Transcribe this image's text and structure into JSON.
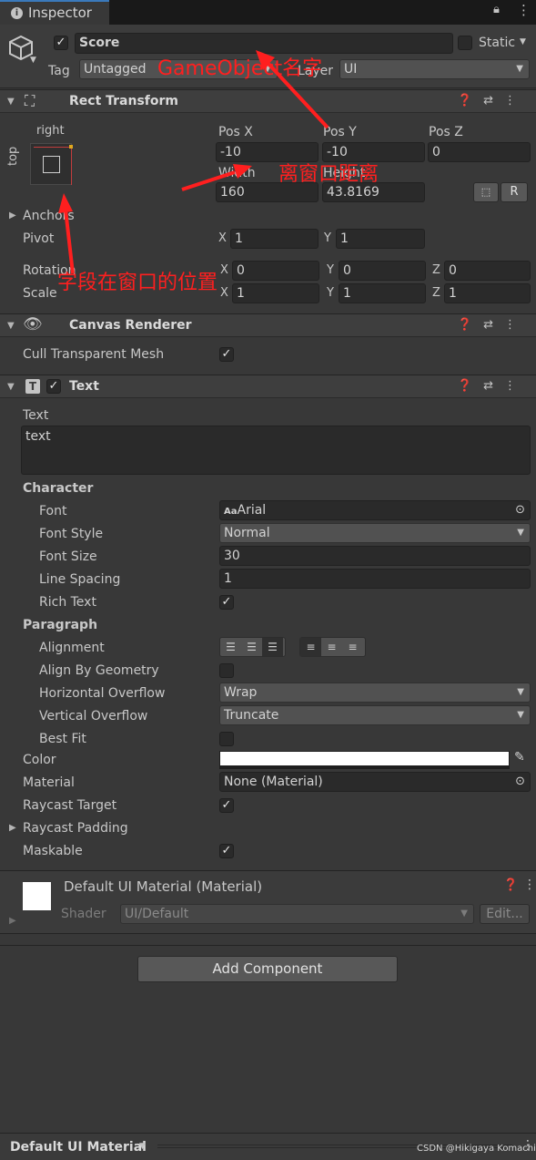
{
  "window": {
    "tab_title": "Inspector"
  },
  "gameobject": {
    "name": "Score",
    "static_label": "Static",
    "tag_label": "Tag",
    "tag_value": "Untagged",
    "layer_label": "Layer",
    "layer_value": "UI"
  },
  "rect_transform": {
    "title": "Rect Transform",
    "anchor_h": "right",
    "anchor_v": "top",
    "posx_label": "Pos X",
    "posy_label": "Pos Y",
    "posz_label": "Pos Z",
    "posx": "-10",
    "posy": "-10",
    "posz": "0",
    "width_label": "Width",
    "height_label": "Height",
    "width": "160",
    "height": "43.8169",
    "r_button": "R",
    "anchors_label": "Anchors",
    "pivot_label": "Pivot",
    "pivot_x": "1",
    "pivot_y": "1",
    "rotation_label": "Rotation",
    "rot_x": "0",
    "rot_y": "0",
    "rot_z": "0",
    "scale_label": "Scale",
    "scale_x": "1",
    "scale_y": "1",
    "scale_z": "1",
    "axis_x": "X",
    "axis_y": "Y",
    "axis_z": "Z"
  },
  "canvas_renderer": {
    "title": "Canvas Renderer",
    "cull_label": "Cull Transparent Mesh"
  },
  "text_component": {
    "title": "Text",
    "text_label": "Text",
    "text_value": "text",
    "character_label": "Character",
    "font_label": "Font",
    "font_value": "Arial",
    "font_style_label": "Font Style",
    "font_style_value": "Normal",
    "font_size_label": "Font Size",
    "font_size_value": "30",
    "line_spacing_label": "Line Spacing",
    "line_spacing_value": "1",
    "rich_text_label": "Rich Text",
    "paragraph_label": "Paragraph",
    "alignment_label": "Alignment",
    "align_geometry_label": "Align By Geometry",
    "h_overflow_label": "Horizontal Overflow",
    "h_overflow_value": "Wrap",
    "v_overflow_label": "Vertical Overflow",
    "v_overflow_value": "Truncate",
    "best_fit_label": "Best Fit",
    "color_label": "Color",
    "material_label": "Material",
    "material_value": "None (Material)",
    "raycast_target_label": "Raycast Target",
    "raycast_padding_label": "Raycast Padding",
    "maskable_label": "Maskable"
  },
  "material_section": {
    "title": "Default UI Material (Material)",
    "shader_label": "Shader",
    "shader_value": "UI/Default",
    "edit_button": "Edit..."
  },
  "add_component_button": "Add Component",
  "footer": {
    "preview_label": "Default UI Material",
    "watermark": "CSDN @Hikigaya Komachi"
  },
  "annotations": {
    "name_note": "GameObject名字",
    "distance_note": "离窗口距离",
    "position_note": "字段在窗口的位置"
  },
  "colors": {
    "annotation": "#ff1f1f",
    "background": "#383838",
    "field": "#2a2a2a"
  }
}
